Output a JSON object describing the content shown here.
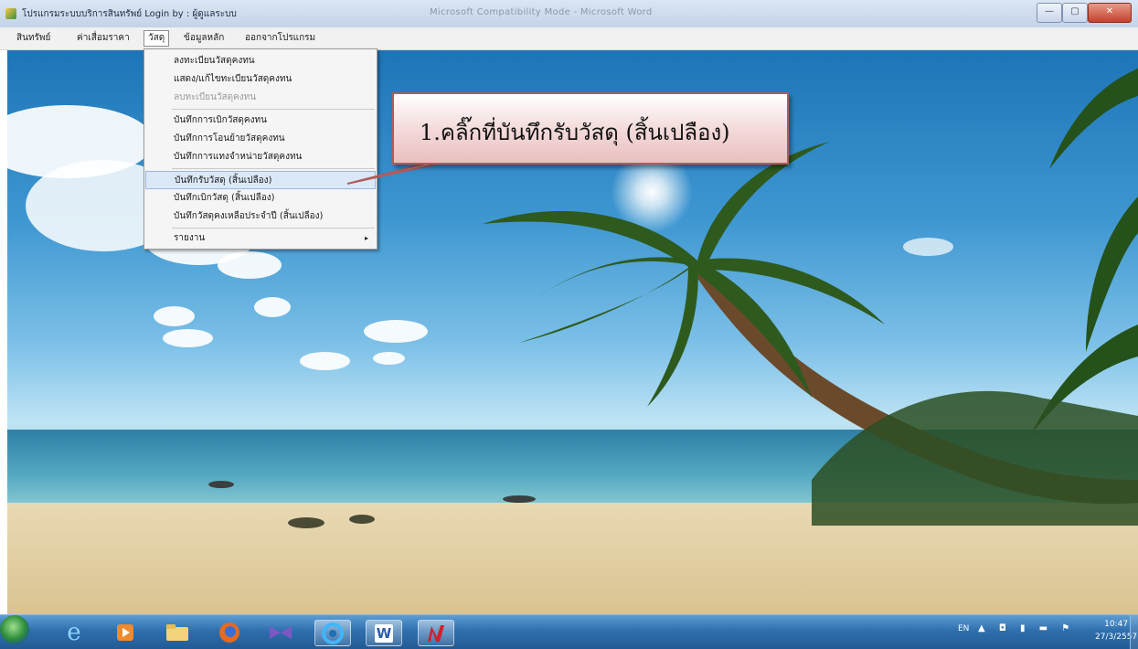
{
  "window": {
    "title": "โปรแกรมระบบบริการสินทรัพย์   Login by : ผู้ดูแลระบบ",
    "background_title": "Microsoft Compatibility Mode - Microsoft Word",
    "btn_min": "—",
    "btn_max": "▢",
    "btn_close": "✕"
  },
  "menubar": {
    "items": [
      "สินทรัพย์",
      "ค่าเสื่อมราคา",
      "วัสดุ",
      "ข้อมูลหลัก",
      "ออกจากโปรแกรม"
    ]
  },
  "dropdown": {
    "items": [
      "ลงทะเบียนวัสดุคงทน",
      "แสดง/แก้ไขทะเบียนวัสดุคงทน",
      "ลบทะเบียนวัสดุคงทน",
      "บันทึกการเบิกวัสดุคงทน",
      "บันทึกการโอนย้ายวัสดุคงทน",
      "บันทึกการแทงจำหน่ายวัสดุคงทน",
      "บันทึกรับวัสดุ (สิ้นเปลือง)",
      "บันทึกเบิกวัสดุ (สิ้นเปลือง)",
      "บันทึกวัสดุคงเหลือประจำปี (สิ้นเปลือง)",
      "รายงาน"
    ],
    "submenu_arrow": "▸"
  },
  "callout": {
    "text": "1.คลิ๊กที่บันทึกรับวัสดุ (สิ้นเปลือง)"
  },
  "taskbar": {
    "ie_glyph": "e",
    "word_glyph": "W",
    "lang": "EN",
    "tray_icons": "▲ ◘ ▮ ▬ ⚑",
    "time": "10:47",
    "date": "27/3/2557"
  },
  "colors": {
    "callout_border": "#b15b5b",
    "taskbar": "#2f6fae",
    "highlight": "#dbe8f8"
  }
}
